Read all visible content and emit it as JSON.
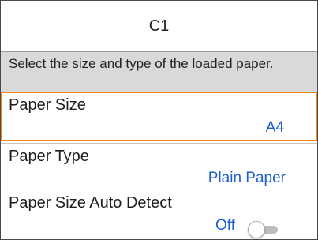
{
  "header": {
    "title": "C1"
  },
  "message": {
    "text": "Select the size and type of the loaded paper."
  },
  "settings": [
    {
      "label": "Paper Size",
      "value": "A4",
      "selected": true
    },
    {
      "label": "Paper Type",
      "value": "Plain Paper",
      "selected": false
    },
    {
      "label": "Paper Size Auto Detect",
      "value": "Off",
      "toggle_on": false
    }
  ],
  "colors": {
    "accent": "#f08a1e",
    "value_text": "#1c5fd0",
    "message_bg": "#d9d9d9"
  }
}
